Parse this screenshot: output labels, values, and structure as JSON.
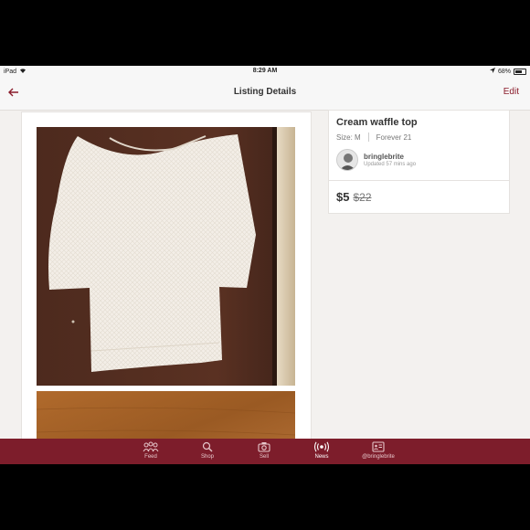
{
  "status_bar": {
    "device": "iPad",
    "time": "8:29 AM",
    "battery": "68%"
  },
  "nav": {
    "title": "Listing Details",
    "edit_label": "Edit"
  },
  "listing": {
    "title": "Cream waffle top",
    "size": "Size: M",
    "brand": "Forever 21",
    "seller": "bringlebrite",
    "updated": "Updated 57 mins ago",
    "price": "$5",
    "original_price": "$22"
  },
  "tabs": [
    {
      "label": "Feed",
      "icon": "feed-icon"
    },
    {
      "label": "Shop",
      "icon": "search-icon"
    },
    {
      "label": "Sell",
      "icon": "camera-icon"
    },
    {
      "label": "News",
      "icon": "broadcast-icon"
    },
    {
      "label": "@bringlebrite",
      "icon": "closet-icon"
    }
  ],
  "colors": {
    "accent": "#8a1c2b",
    "tab_bar": "#7d1d2b",
    "background": "#f3f1ef"
  }
}
